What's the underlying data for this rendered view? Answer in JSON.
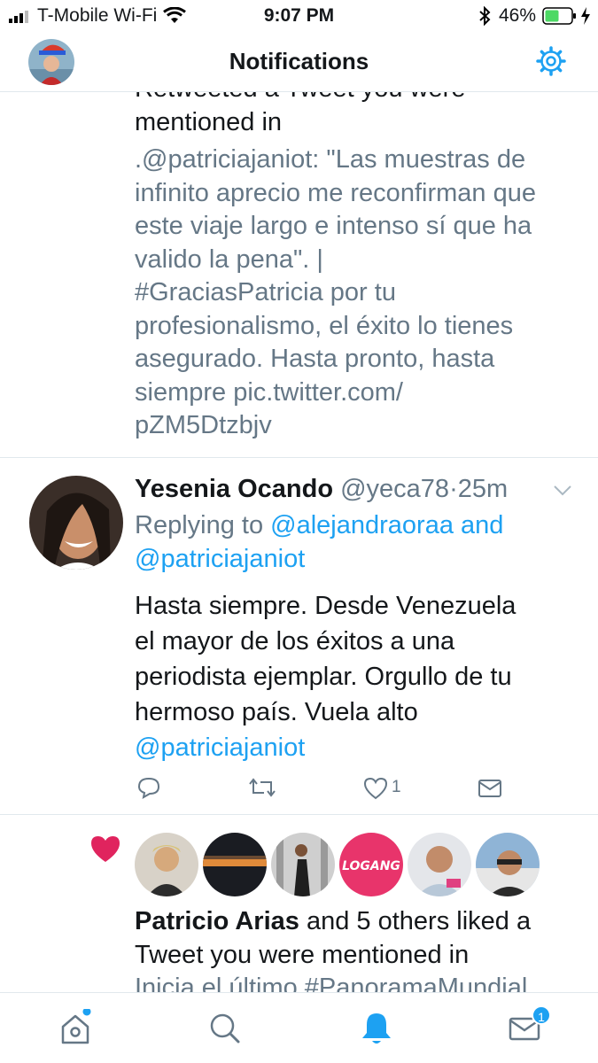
{
  "status_bar": {
    "carrier": "T-Mobile Wi-Fi",
    "time": "9:07 PM",
    "battery": "46%"
  },
  "header": {
    "title": "Notifications"
  },
  "first_notification": {
    "action_line_1": "Retweeted a Tweet you were",
    "action_line_2": "mentioned in",
    "text_lines": [
      ".@patriciajaniot: \"Las muestras de",
      "infinito aprecio me reconfirman que",
      "este viaje largo e intenso sí que ha",
      "valido la pena\". |",
      "#GraciasPatricia por tu",
      "profesionalismo, el éxito lo tienes",
      "asegurado. Hasta pronto, hasta",
      "siempre pic.twitter.com/",
      "pZM5Dtzbjv"
    ]
  },
  "tweet": {
    "author_name": "Yesenia Ocando",
    "handle": "@yeca78",
    "separator": "·",
    "time_ago": "25m",
    "replying_prefix": "Replying to",
    "replying_user_1": "@alejandraoraa",
    "replying_and": "and",
    "replying_user_2": "@patriciajaniot",
    "text_lines": [
      "Hasta siempre. Desde Venezuela",
      "el mayor de los éxitos a una",
      "periodista ejemplar. Orgullo de tu",
      "hermoso país. Vuela alto"
    ],
    "mention": "@patriciajaniot",
    "like_count": "1"
  },
  "like_notification": {
    "liker_name": "Patricio Arias",
    "rest_line_1": " and 5 others liked a",
    "line_2": "Tweet you were mentioned in",
    "preview": "Inicia el último #PanoramaMundial"
  },
  "tabbar": {
    "messages_badge": "1"
  },
  "colors": {
    "accent": "#1da1f2",
    "heart": "#e0245e",
    "gray_text": "#657786"
  }
}
